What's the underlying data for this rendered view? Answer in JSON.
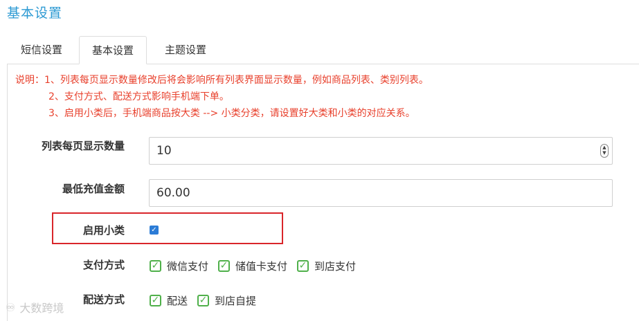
{
  "header": {
    "title": "基本设置"
  },
  "tabs": [
    {
      "label": "短信设置",
      "active": false
    },
    {
      "label": "基本设置",
      "active": true
    },
    {
      "label": "主题设置",
      "active": false
    }
  ],
  "notes": {
    "line1": "说明：1、列表每页显示数量修改后将会影响所有列表界面显示数量，例如商品列表、类别列表。",
    "line2": "2、支付方式、配送方式影响手机端下单。",
    "line3": "3、启用小类后，手机端商品按大类 --> 小类分类，请设置好大类和小类的对应关系。"
  },
  "form": {
    "page_size": {
      "label": "列表每页显示数量",
      "value": "10"
    },
    "min_recharge": {
      "label": "最低充值金额",
      "value": "60.00"
    },
    "subcategory": {
      "label": "启用小类",
      "checked": true
    },
    "payment": {
      "label": "支付方式",
      "options": [
        "微信支付",
        "储值卡支付",
        "到店支付"
      ]
    },
    "delivery": {
      "label": "配送方式",
      "options": [
        "配送",
        "到店自提"
      ]
    }
  },
  "watermark": {
    "text": "大数跨境"
  },
  "colors": {
    "title": "#2d9ad3",
    "notes": "#e8402c",
    "highlight": "#d9252a",
    "check_green": "#4fb04a",
    "check_blue": "#2c7cd6"
  }
}
